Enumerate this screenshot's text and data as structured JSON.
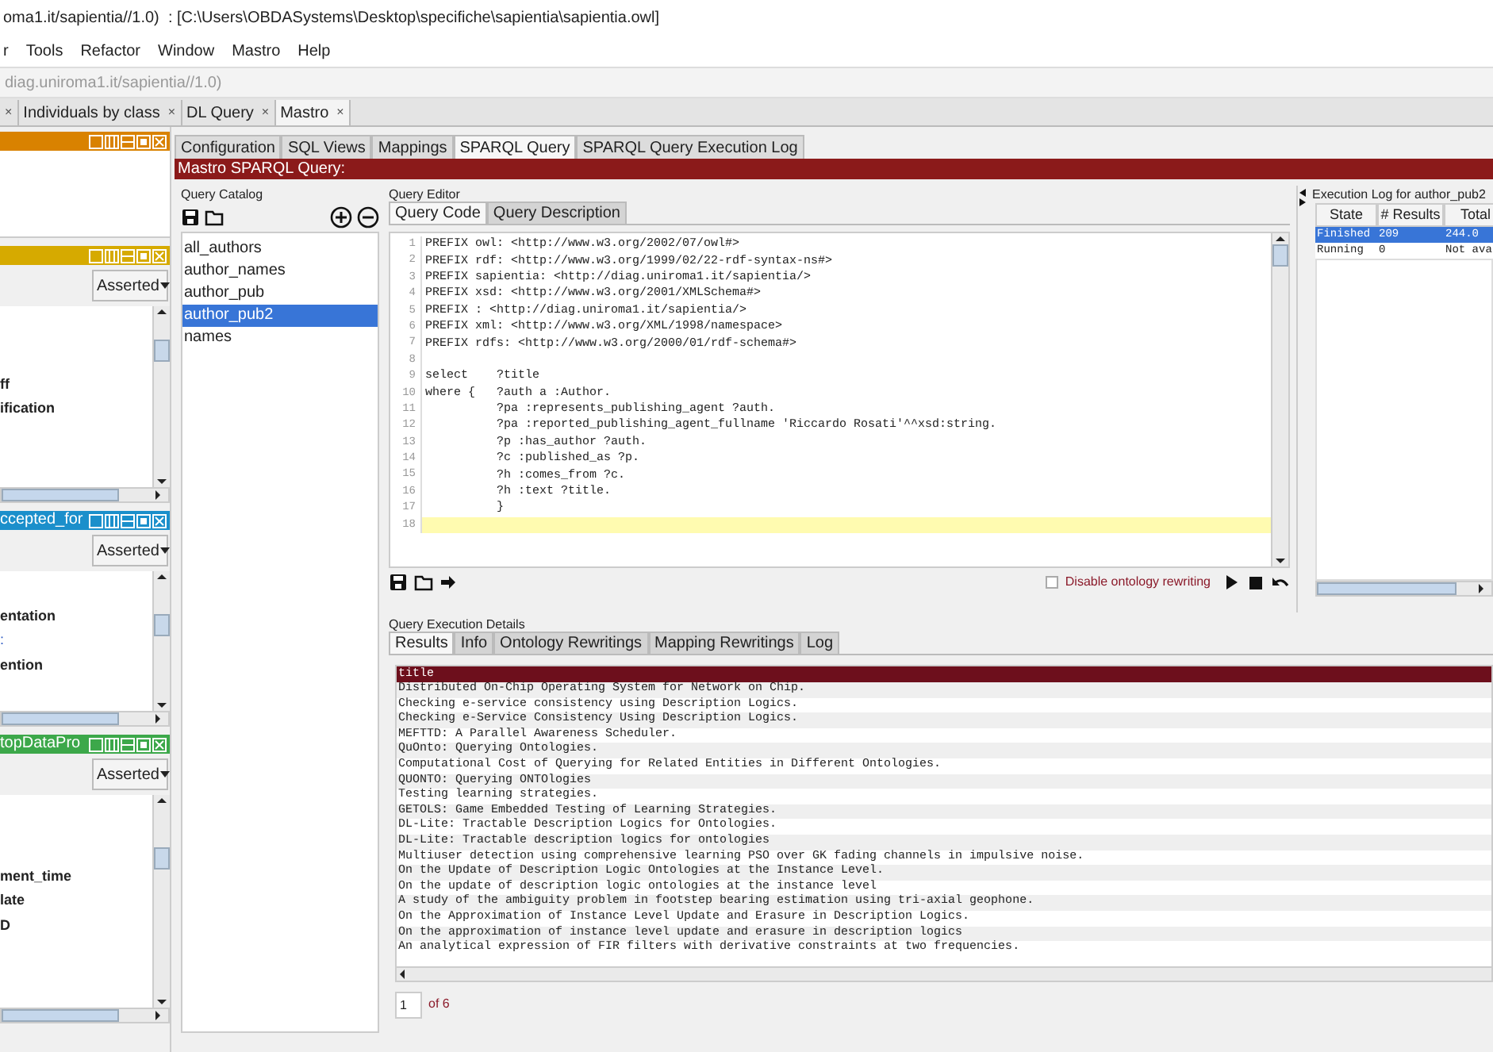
{
  "window": {
    "title": "oma1.it/sapientia//1.0)  : [C:\\Users\\OBDASystems\\Desktop\\specifiche\\sapientia\\sapientia.owl]"
  },
  "menu": [
    "r",
    "Tools",
    "Refactor",
    "Window",
    "Mastro",
    "Help"
  ],
  "ontology_iri": "diag.uniroma1.it/sapientia//1.0)",
  "tabs": [
    {
      "close": "×",
      "selected": false
    },
    {
      "label": "Individuals by class",
      "close": "×",
      "selected": false
    },
    {
      "label": "DL Query",
      "close": "×",
      "selected": false
    },
    {
      "label": "Mastro",
      "close": "×",
      "selected": true
    }
  ],
  "left_panels": [
    {
      "kind": "plain",
      "color": "#d98200"
    },
    {
      "kind": "list",
      "color": "#d6aa00",
      "dropdown": "Asserted",
      "items": [
        {
          "text": "ff",
          "kind": "bold"
        },
        {
          "text": "ification",
          "kind": "bold"
        }
      ]
    },
    {
      "kind": "list",
      "color": "#1b8fcb",
      "title": "ccepted_for",
      "dropdown": "Asserted",
      "items": [
        {
          "text": "entation",
          "kind": "bold"
        },
        {
          "text": ":",
          "kind": "link"
        },
        {
          "text": "ention",
          "kind": "bold"
        }
      ]
    },
    {
      "kind": "list",
      "color": "#3ca84a",
      "title": "topDataPro",
      "dropdown": "Asserted",
      "items": [
        {
          "text": "ment_time",
          "kind": "bold"
        },
        {
          "text": "late",
          "kind": "bold"
        },
        {
          "text": "D",
          "kind": "bold"
        }
      ]
    }
  ],
  "inner_tabs": [
    {
      "label": "Configuration",
      "selected": false
    },
    {
      "label": "SQL Views",
      "selected": false
    },
    {
      "label": "Mappings",
      "selected": false
    },
    {
      "label": "SPARQL Query",
      "selected": true
    },
    {
      "label": "SPARQL Query Execution Log",
      "selected": false
    }
  ],
  "banner": "Mastro SPARQL Query:",
  "catalog": {
    "title": "Query Catalog",
    "items": [
      {
        "label": "all_authors",
        "selected": false
      },
      {
        "label": "author_names",
        "selected": false
      },
      {
        "label": "author_pub",
        "selected": false
      },
      {
        "label": "author_pub2",
        "selected": true
      },
      {
        "label": "names",
        "selected": false
      }
    ]
  },
  "editor": {
    "title": "Query Editor",
    "tabs": [
      {
        "label": "Query Code",
        "selected": true
      },
      {
        "label": "Query Description",
        "selected": false
      }
    ],
    "lines": [
      {
        "number": "1",
        "text": "PREFIX owl: <http://www.w3.org/2002/07/owl#>",
        "current": false
      },
      {
        "number": "2",
        "text": "PREFIX rdf: <http://www.w3.org/1999/02/22-rdf-syntax-ns#>",
        "current": false
      },
      {
        "number": "3",
        "text": "PREFIX sapientia: <http://diag.uniroma1.it/sapientia/>",
        "current": false
      },
      {
        "number": "4",
        "text": "PREFIX xsd: <http://www.w3.org/2001/XMLSchema#>",
        "current": false
      },
      {
        "number": "5",
        "text": "PREFIX : <http://diag.uniroma1.it/sapientia/>",
        "current": false
      },
      {
        "number": "6",
        "text": "PREFIX xml: <http://www.w3.org/XML/1998/namespace>",
        "current": false
      },
      {
        "number": "7",
        "text": "PREFIX rdfs: <http://www.w3.org/2000/01/rdf-schema#>",
        "current": false
      },
      {
        "number": "8",
        "current": false
      },
      {
        "number": "9",
        "text": "select    ?title",
        "current": false
      },
      {
        "number": "10",
        "text": "where {   ?auth a :Author.",
        "current": false
      },
      {
        "number": "11",
        "text": "          ?pa :represents_publishing_agent ?auth.",
        "current": false
      },
      {
        "number": "12",
        "text": "          ?pa :reported_publishing_agent_fullname 'Riccardo Rosati'^^xsd:string.",
        "current": false
      },
      {
        "number": "13",
        "text": "          ?p :has_author ?auth.",
        "current": false
      },
      {
        "number": "14",
        "text": "          ?c :published_as ?p.",
        "current": false
      },
      {
        "number": "15",
        "text": "          ?h :comes_from ?c.",
        "current": false
      },
      {
        "number": "16",
        "text": "          ?h :text ?title.",
        "current": false
      },
      {
        "number": "17",
        "text": "          }",
        "current": false
      },
      {
        "number": "18",
        "current": true
      }
    ],
    "disable_rewriting": {
      "label": "Disable ontology rewriting",
      "checked": false
    }
  },
  "log": {
    "title": "Execution Log for author_pub2",
    "columns": [
      "State",
      "# Results",
      "Total"
    ],
    "rows": [
      {
        "cells": [
          "Finished",
          "209",
          "244.0"
        ],
        "selected": true
      },
      {
        "cells": [
          "Running",
          "0",
          "Not ava"
        ],
        "selected": false
      }
    ]
  },
  "details": {
    "title": "Query Execution Details",
    "tabs": [
      {
        "label": "Results",
        "selected": true
      },
      {
        "label": "Info",
        "selected": false
      },
      {
        "label": "Ontology Rewritings",
        "selected": false
      },
      {
        "label": "Mapping Rewritings",
        "selected": false
      },
      {
        "label": "Log",
        "selected": false
      }
    ],
    "columns": [
      "title"
    ],
    "rows": [
      "Distributed On-Chip Operating System for Network on Chip.",
      "Checking e-service consistency using Description Logics.",
      "Checking e-Service Consistency Using Description Logics.",
      "MEFTTD: A Parallel Awareness Scheduler.",
      "QuOnto: Querying Ontologies.",
      "Computational Cost of Querying for Related Entities in Different Ontologies.",
      "QUONTO: Querying ONTOlogies",
      "Testing learning strategies.",
      "GETOLS: Game Embedded Testing of Learning Strategies.",
      "DL-Lite: Tractable Description Logics for Ontologies.",
      "DL-Lite: Tractable description logics for ontologies",
      "Multiuser detection using comprehensive learning PSO over GK fading channels in impulsive noise.",
      "On the Update of Description Logic Ontologies at the Instance Level.",
      "On the update of description logic ontologies at the instance level",
      "A study of the ambiguity problem in footstep bearing estimation using tri-axial geophone.",
      "On the Approximation of Instance Level Update and Erasure in Description Logics.",
      "On the approximation of instance level update and erasure in description logics",
      "An analytical expression of FIR filters with derivative constraints at two frequencies."
    ],
    "page": "1",
    "page_total": "of 6"
  }
}
